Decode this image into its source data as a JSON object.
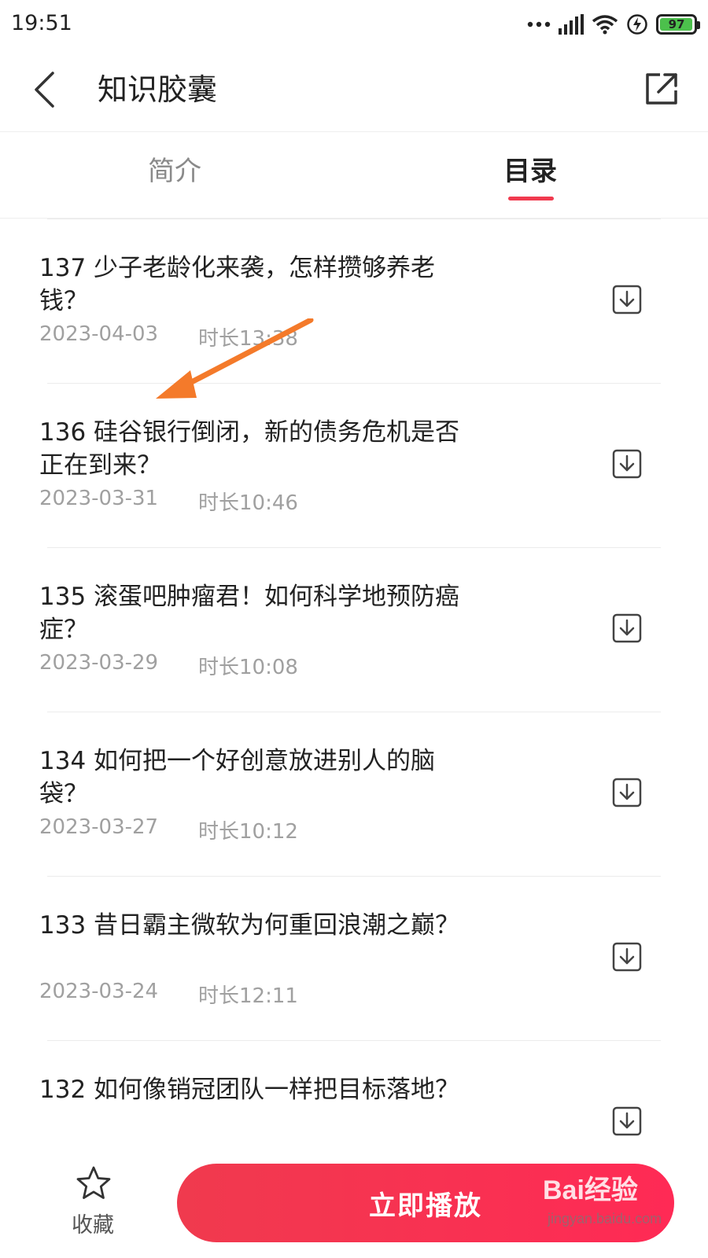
{
  "status_bar": {
    "time": "19:51",
    "battery": "97",
    "battery_level": 0.97,
    "icons": [
      "more-dots-icon",
      "signal-icon",
      "wifi-icon",
      "charging-icon",
      "battery-icon"
    ]
  },
  "header": {
    "title": "知识胶囊",
    "back_icon": "chevron-left-icon",
    "share_icon": "share-icon"
  },
  "tabs": [
    {
      "label": "简介",
      "active": false
    },
    {
      "label": "目录",
      "active": true
    }
  ],
  "episodes": [
    {
      "title": "137 少子老龄化来袭，怎样攒够养老钱？",
      "date": "2023-04-03",
      "duration": "时长13:38"
    },
    {
      "title": "136 硅谷银行倒闭，新的债务危机是否正在到来？",
      "date": "2023-03-31",
      "duration": "时长10:46"
    },
    {
      "title": "135 滚蛋吧肿瘤君！如何科学地预防癌症？",
      "date": "2023-03-29",
      "duration": "时长10:08"
    },
    {
      "title": "134 如何把一个好创意放进别人的脑袋？",
      "date": "2023-03-27",
      "duration": "时长10:12"
    },
    {
      "title": "133 昔日霸主微软为何重回浪潮之巅？",
      "date": "2023-03-24",
      "duration": "时长12:11"
    },
    {
      "title": "132 如何像销冠团队一样把目标落地？",
      "date": "",
      "duration": ""
    }
  ],
  "bottom_bar": {
    "favorite_label": "收藏",
    "play_label": "立即播放"
  },
  "watermark": {
    "logo": "Bai经验",
    "sub": "jingyan.baidu.com"
  },
  "colors": {
    "accent": "#f03a4e",
    "arrow": "#f47a2a",
    "battery_fill": "#4cc04c"
  }
}
